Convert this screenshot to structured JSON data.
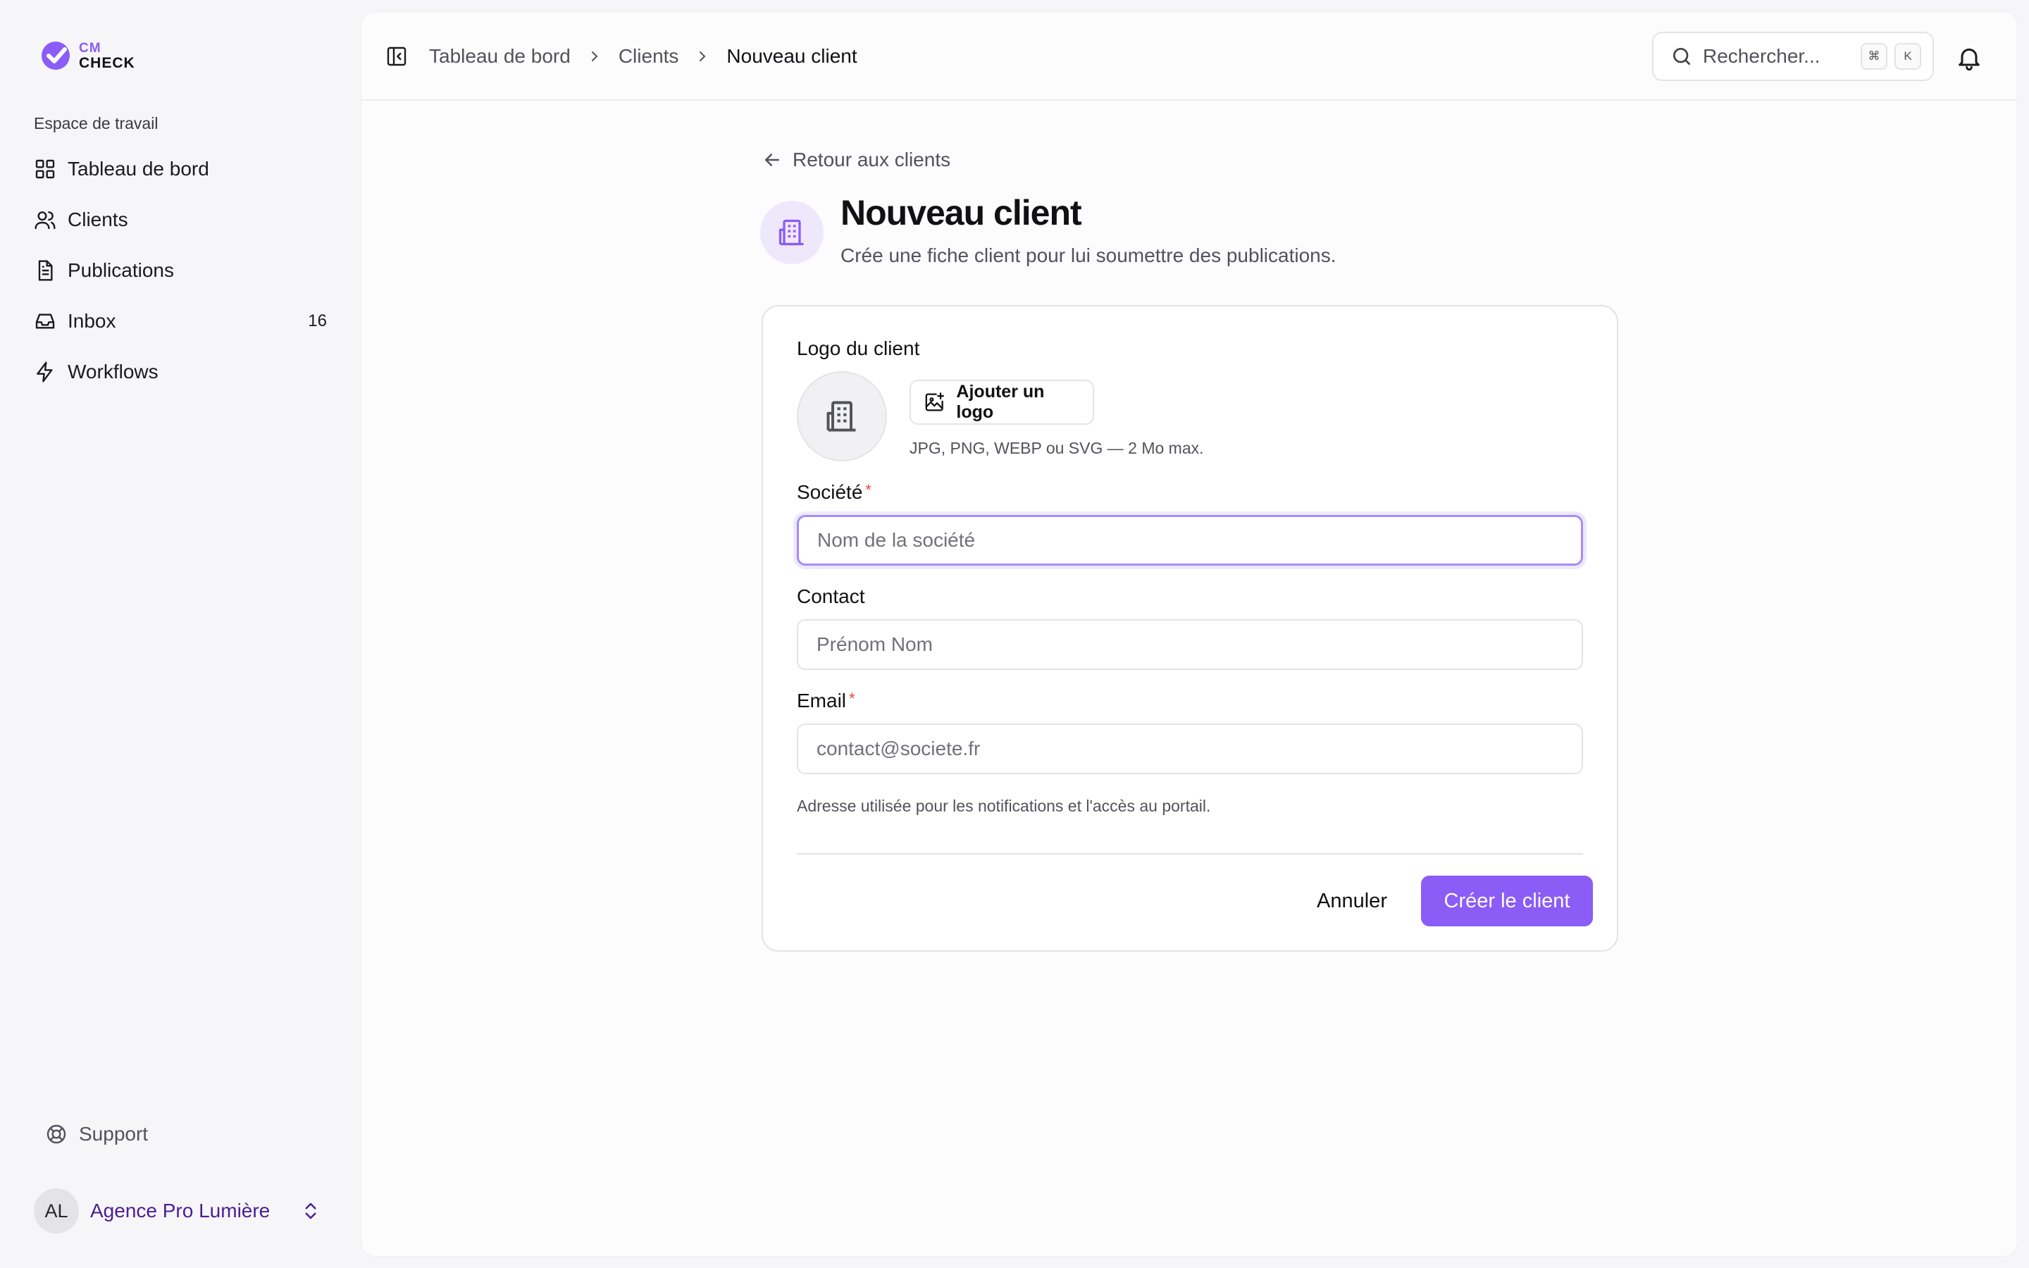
{
  "app": {
    "logo_cm": "CM",
    "logo_check": "CHECK"
  },
  "sidebar": {
    "workspace_label": "Espace de travail",
    "items": [
      {
        "label": "Tableau de bord",
        "icon": "dashboard-icon"
      },
      {
        "label": "Clients",
        "icon": "users-icon"
      },
      {
        "label": "Publications",
        "icon": "document-icon"
      },
      {
        "label": "Inbox",
        "icon": "inbox-icon",
        "badge": "16"
      },
      {
        "label": "Workflows",
        "icon": "lightning-icon"
      }
    ],
    "support_label": "Support",
    "account": {
      "initials": "AL",
      "name": "Agence Pro Lumière"
    }
  },
  "topbar": {
    "breadcrumb": [
      "Tableau de bord",
      "Clients",
      "Nouveau client"
    ],
    "search_placeholder": "Rechercher...",
    "shortcut_keys": [
      "⌘",
      "K"
    ]
  },
  "page": {
    "back_label": "Retour aux clients",
    "title": "Nouveau client",
    "subtitle": "Crée une fiche client pour lui soumettre des publications."
  },
  "form": {
    "logo_label": "Logo du client",
    "upload_label": "Ajouter un logo",
    "upload_hint": "JPG, PNG, WEBP ou SVG — 2 Mo max.",
    "company_label": "Société",
    "company_placeholder": "Nom de la société",
    "contact_label": "Contact",
    "contact_placeholder": "Prénom Nom",
    "email_label": "Email",
    "email_placeholder": "contact@societe.fr",
    "email_hint": "Adresse utilisée pour les notifications et l'accès au portail.",
    "required_mark": "*",
    "cancel_label": "Annuler",
    "submit_label": "Créer le client"
  },
  "colors": {
    "accent": "#8b5cf6",
    "accent_soft": "#efe8fd",
    "required": "#ef4444"
  }
}
